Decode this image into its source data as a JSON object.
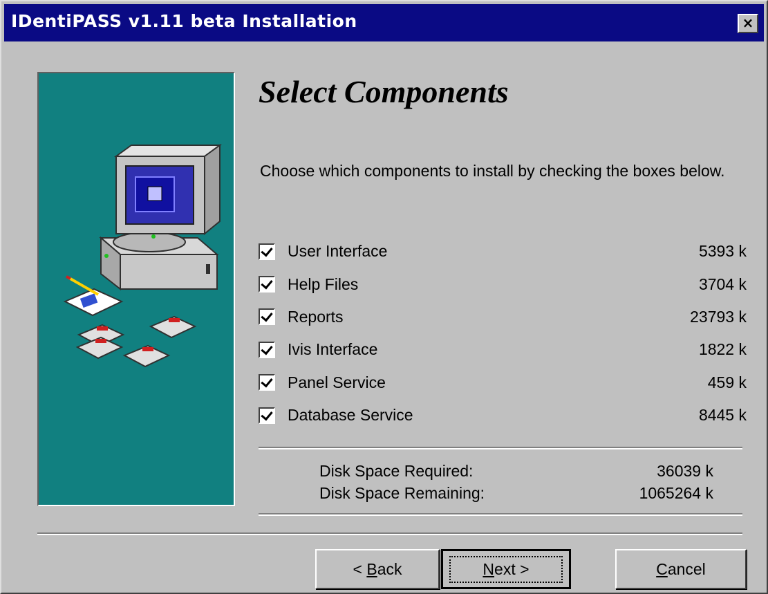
{
  "window": {
    "title": "IDentiPASS v1.11 beta Installation",
    "close_glyph": "×"
  },
  "page": {
    "heading": "Select Components",
    "description": "Choose which components to install by checking the boxes below."
  },
  "components": [
    {
      "label": "User Interface",
      "size": "5393 k",
      "checked": true
    },
    {
      "label": "Help Files",
      "size": "3704 k",
      "checked": true
    },
    {
      "label": "Reports",
      "size": "23793 k",
      "checked": true
    },
    {
      "label": "Ivis Interface",
      "size": "1822 k",
      "checked": true
    },
    {
      "label": "Panel Service",
      "size": "459 k",
      "checked": true
    },
    {
      "label": "Database Service",
      "size": "8445 k",
      "checked": true
    }
  ],
  "disk": {
    "required_label": "Disk Space Required:",
    "required_value": "36039 k",
    "remaining_label": "Disk Space Remaining:",
    "remaining_value": "1065264 k"
  },
  "buttons": {
    "back_prefix": "< ",
    "back_mnemonic": "B",
    "back_rest": "ack",
    "next_mnemonic": "N",
    "next_rest": "ext >",
    "cancel_mnemonic": "C",
    "cancel_rest": "ancel"
  },
  "colors": {
    "titlebar": "#0a0a84",
    "art_background": "#118080",
    "dialog_face": "#c0c0c0"
  }
}
